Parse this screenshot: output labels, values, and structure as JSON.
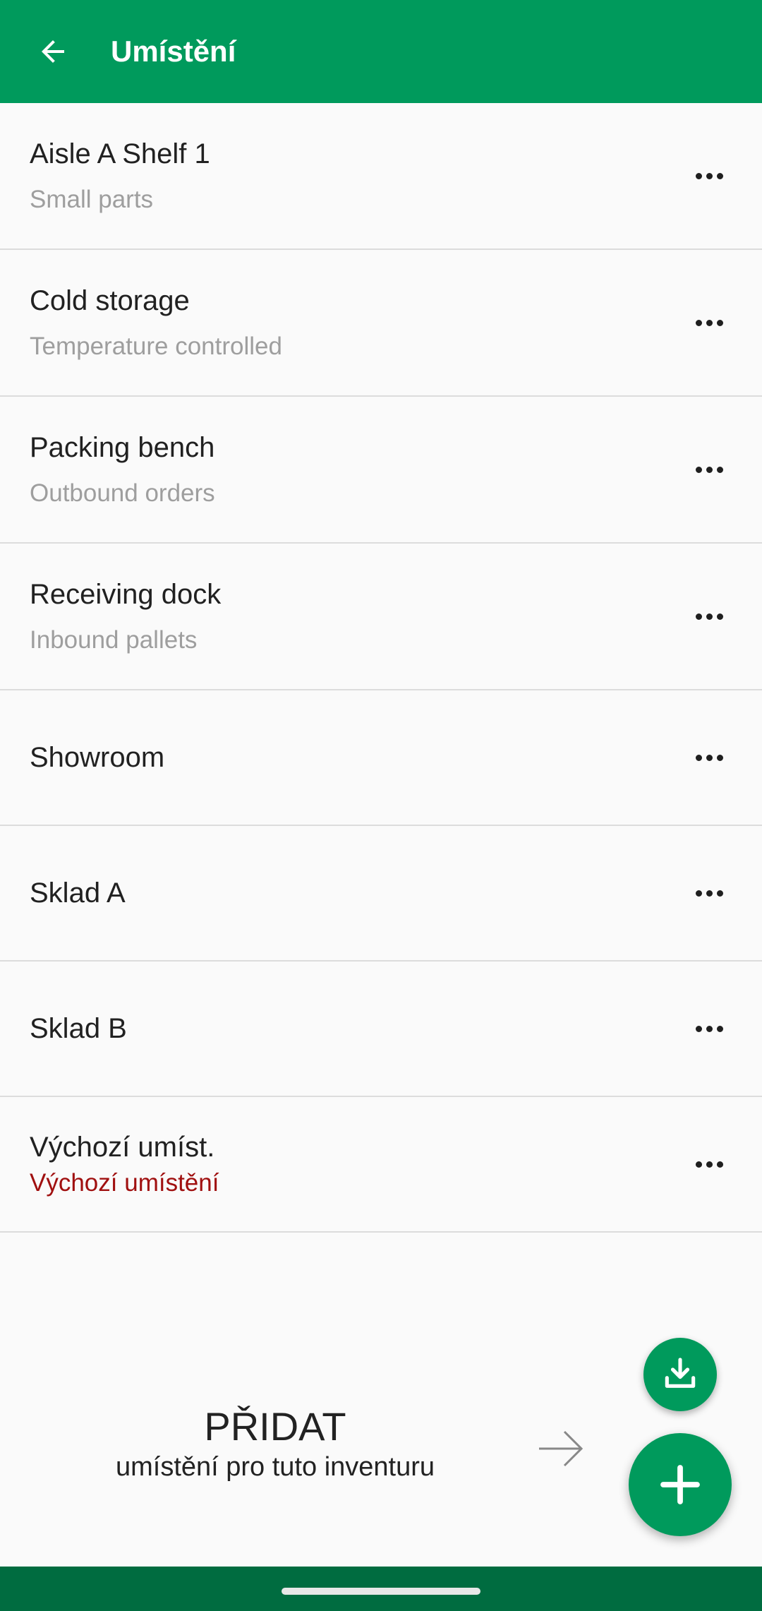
{
  "app_bar": {
    "title": "Umístění",
    "back_icon": "arrow-back-icon"
  },
  "locations": [
    {
      "name": "Aisle A Shelf 1",
      "description": "Small parts"
    },
    {
      "name": "Cold storage",
      "description": "Temperature controlled"
    },
    {
      "name": "Packing bench",
      "description": "Outbound orders"
    },
    {
      "name": "Receiving dock",
      "description": "Inbound pallets"
    },
    {
      "name": "Showroom",
      "description": ""
    },
    {
      "name": "Sklad A",
      "description": ""
    },
    {
      "name": "Sklad B",
      "description": ""
    },
    {
      "name": "Výchozí umíst.",
      "description": "Výchozí umístění",
      "description_color": "#a01010"
    }
  ],
  "more_icon": "more-horizontal-icon",
  "add_hint": {
    "title": "PŘIDAT",
    "subtitle": "umístění pro tuto inventuru"
  },
  "fabs": {
    "import_icon": "download-icon",
    "add_icon": "plus-icon"
  },
  "colors": {
    "primary": "#009a5c",
    "nav_bar": "#006c40",
    "warning_text": "#a01010"
  }
}
